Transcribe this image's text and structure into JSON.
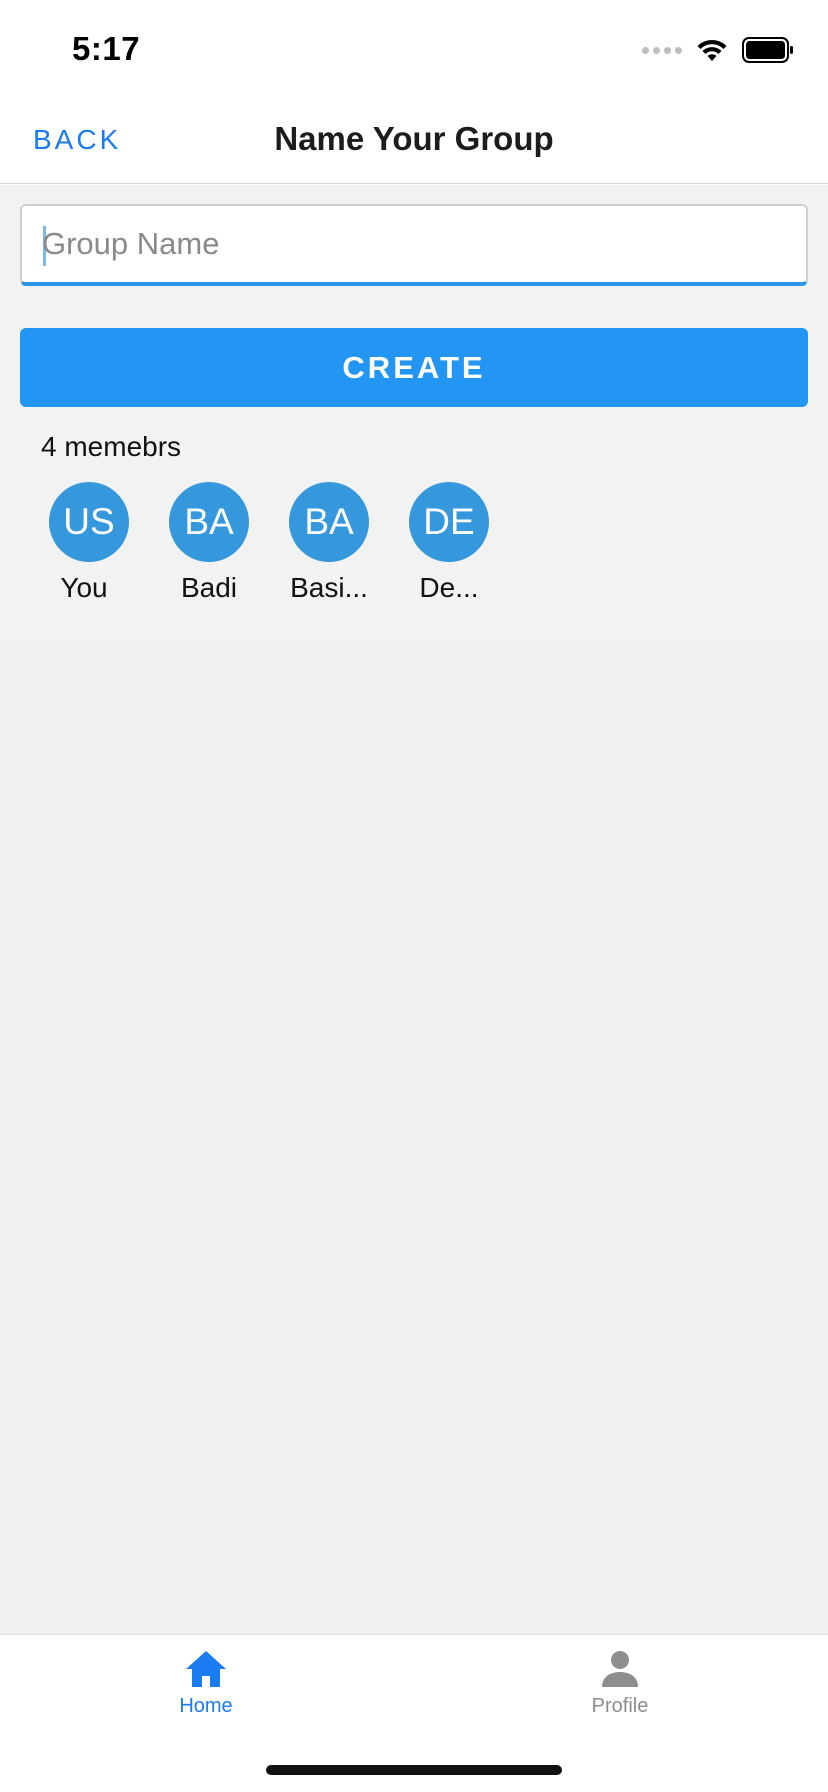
{
  "status_bar": {
    "time": "5:17"
  },
  "nav": {
    "back_label": "BACK",
    "title": "Name Your Group"
  },
  "form": {
    "group_name_placeholder": "Group Name",
    "group_name_value": "",
    "create_label": "CREATE"
  },
  "members": {
    "count_label": "4 memebrs",
    "items": [
      {
        "initials": "US",
        "name": "You"
      },
      {
        "initials": "BA",
        "name": "Badi"
      },
      {
        "initials": "BA",
        "name": "Basi..."
      },
      {
        "initials": "DE",
        "name": "De..."
      }
    ]
  },
  "tab_bar": {
    "tabs": [
      {
        "label": "Home",
        "icon": "home-icon",
        "active": true
      },
      {
        "label": "Profile",
        "icon": "person-icon",
        "active": false
      }
    ]
  },
  "colors": {
    "accent": "#1a7cf0",
    "button": "#2396f3",
    "avatar": "#3598dc",
    "input_underline": "#2b95e8",
    "background": "#f0f0f0"
  }
}
